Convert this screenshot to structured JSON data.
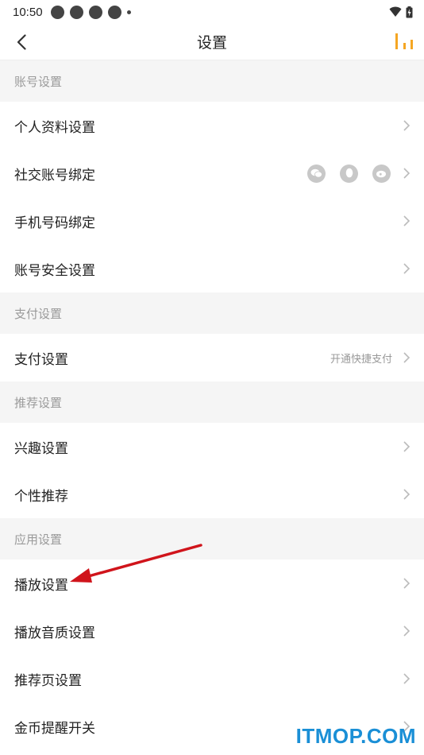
{
  "status_bar": {
    "time": "10:50"
  },
  "nav": {
    "title": "设置"
  },
  "sections": [
    {
      "header": "账号设置",
      "items": [
        {
          "label": "个人资料设置"
        },
        {
          "label": "社交账号绑定",
          "social_icons": [
            "wechat-icon",
            "qq-icon",
            "weibo-icon"
          ]
        },
        {
          "label": "手机号码绑定"
        },
        {
          "label": "账号安全设置"
        }
      ]
    },
    {
      "header": "支付设置",
      "items": [
        {
          "label": "支付设置",
          "hint": "开通快捷支付"
        }
      ]
    },
    {
      "header": "推荐设置",
      "items": [
        {
          "label": "兴趣设置"
        },
        {
          "label": "个性推荐"
        }
      ]
    },
    {
      "header": "应用设置",
      "items": [
        {
          "label": "播放设置"
        },
        {
          "label": "播放音质设置"
        },
        {
          "label": "推荐页设置"
        },
        {
          "label": "金币提醒开关"
        }
      ]
    }
  ],
  "watermark": "ITMOP.COM",
  "colors": {
    "accent": "#f5a623",
    "annotation_arrow": "#d0141b",
    "watermark": "#1a8fd6"
  }
}
